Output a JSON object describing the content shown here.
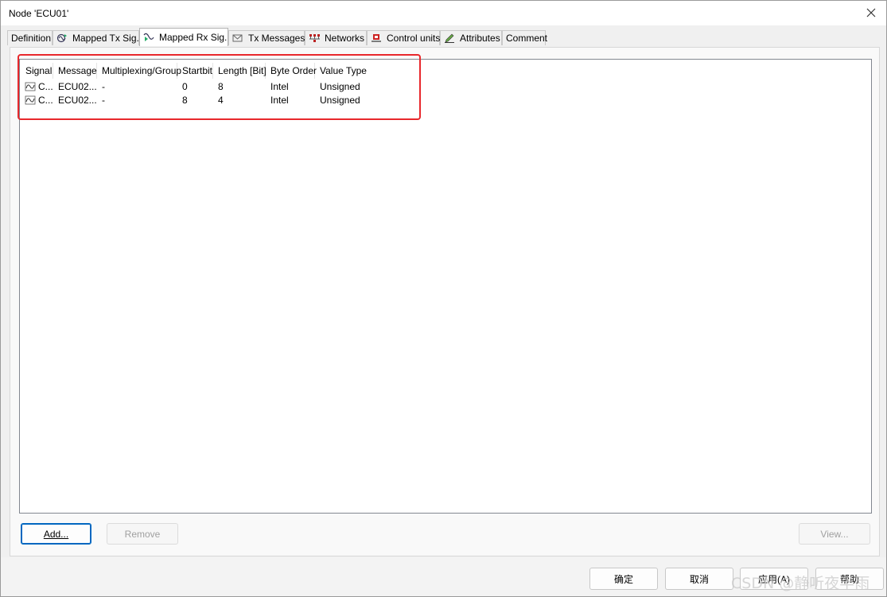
{
  "window": {
    "title": "Node 'ECU01'"
  },
  "tabs": [
    {
      "label": "Definition",
      "icon": "none"
    },
    {
      "label": "Mapped Tx Sig.",
      "icon": "tx-signal-icon"
    },
    {
      "label": "Mapped Rx Sig.",
      "icon": "rx-signal-icon",
      "active": true
    },
    {
      "label": "Tx Messages",
      "icon": "envelope-icon"
    },
    {
      "label": "Networks",
      "icon": "network-icon"
    },
    {
      "label": "Control units",
      "icon": "control-unit-icon"
    },
    {
      "label": "Attributes",
      "icon": "pencil-icon"
    },
    {
      "label": "Comment",
      "icon": "none"
    }
  ],
  "table": {
    "columns": [
      "Signal",
      "Message",
      "Multiplexing/Group",
      "Startbit",
      "Length [Bit]",
      "Byte Order",
      "Value Type"
    ],
    "rows": [
      [
        "C...",
        "ECU02...",
        "-",
        "0",
        "8",
        "Intel",
        "Unsigned"
      ],
      [
        "C...",
        "ECU02...",
        "-",
        "8",
        "4",
        "Intel",
        "Unsigned"
      ]
    ]
  },
  "actions": {
    "add": "Add...",
    "remove": "Remove",
    "view": "View..."
  },
  "dialog_buttons": {
    "ok": "确定",
    "cancel": "取消",
    "apply": "应用(A)",
    "help": "帮助"
  },
  "watermark": "CSDN @静听夜半雨",
  "colors": {
    "highlight": "#e8282c",
    "default_button_border": "#0067c0"
  }
}
